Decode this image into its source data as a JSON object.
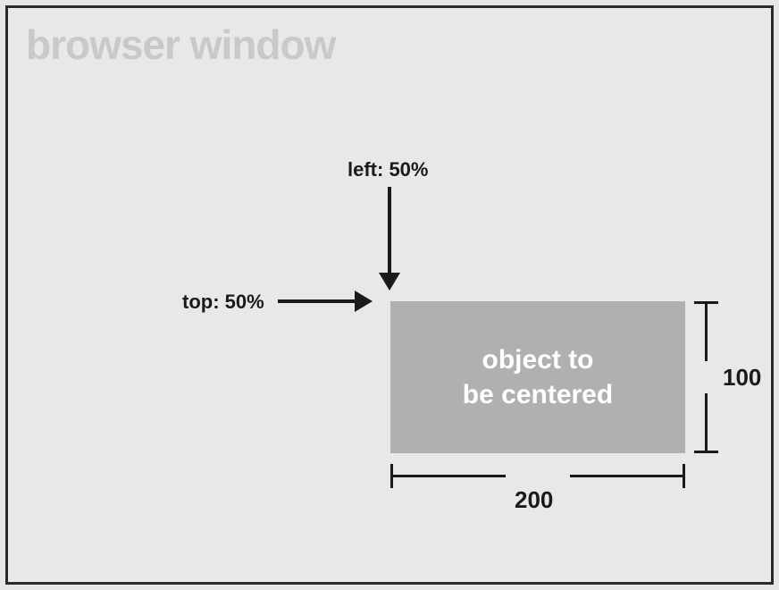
{
  "diagram": {
    "title": "browser window",
    "labels": {
      "left": "left: 50%",
      "top": "top: 50%"
    },
    "box_text": "object to\nbe centered",
    "dimensions": {
      "width": "200",
      "height": "100"
    }
  }
}
